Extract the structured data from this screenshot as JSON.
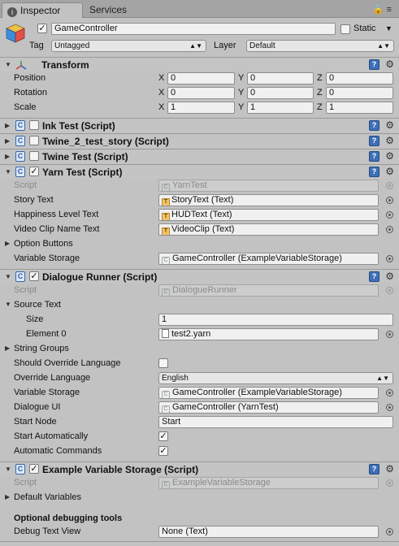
{
  "tabs": {
    "inspector": "Inspector",
    "services": "Services"
  },
  "header": {
    "object_name": "GameController",
    "static_label": "Static",
    "tag_label": "Tag",
    "tag_value": "Untagged",
    "layer_label": "Layer",
    "layer_value": "Default",
    "active": true,
    "static": false
  },
  "transform": {
    "title": "Transform",
    "position_label": "Position",
    "rotation_label": "Rotation",
    "scale_label": "Scale",
    "axes": [
      "X",
      "Y",
      "Z"
    ],
    "position": [
      "0",
      "0",
      "0"
    ],
    "rotation": [
      "0",
      "0",
      "0"
    ],
    "scale": [
      "1",
      "1",
      "1"
    ]
  },
  "collapsed_components": [
    {
      "title": "Ink Test (Script)",
      "enabled": false
    },
    {
      "title": "Twine_2_test_story (Script)",
      "enabled": false
    },
    {
      "title": "Twine Test (Script)",
      "enabled": false
    }
  ],
  "yarn_test": {
    "title": "Yarn Test (Script)",
    "enabled": true,
    "script_label": "Script",
    "script_value": "YarnTest",
    "story_text_label": "Story Text",
    "story_text_value": "StoryText (Text)",
    "happiness_label": "Happiness Level Text",
    "happiness_value": "HUDText (Text)",
    "video_clip_label": "Video Clip Name Text",
    "video_clip_value": "VideoClip (Text)",
    "option_buttons_label": "Option Buttons",
    "variable_storage_label": "Variable Storage",
    "variable_storage_value": "GameController (ExampleVariableStorage)"
  },
  "dialogue_runner": {
    "title": "Dialogue Runner (Script)",
    "enabled": true,
    "script_label": "Script",
    "script_value": "DialogueRunner",
    "source_text_label": "Source Text",
    "size_label": "Size",
    "size_value": "1",
    "element0_label": "Element 0",
    "element0_value": "test2.yarn",
    "string_groups_label": "String Groups",
    "override_lang_label": "Should Override Language",
    "override_language_label": "Override Language",
    "override_language_value": "English",
    "variable_storage_label": "Variable Storage",
    "variable_storage_value": "GameController (ExampleVariableStorage)",
    "dialogue_ui_label": "Dialogue UI",
    "dialogue_ui_value": "GameController (YarnTest)",
    "start_node_label": "Start Node",
    "start_node_value": "Start",
    "start_auto_label": "Start Automatically",
    "auto_commands_label": "Automatic Commands",
    "should_override_language": false,
    "start_automatically": true,
    "automatic_commands": true
  },
  "example_storage": {
    "title": "Example Variable Storage (Script)",
    "enabled": true,
    "script_label": "Script",
    "script_value": "ExampleVariableStorage",
    "default_vars_label": "Default Variables",
    "debug_section_label": "Optional debugging tools",
    "debug_text_label": "Debug Text View",
    "debug_text_value": "None (Text)"
  },
  "icons": {
    "book": "help-book-icon",
    "gear": "gear-icon",
    "lock": "lock-icon",
    "menu": "menu-icon"
  }
}
